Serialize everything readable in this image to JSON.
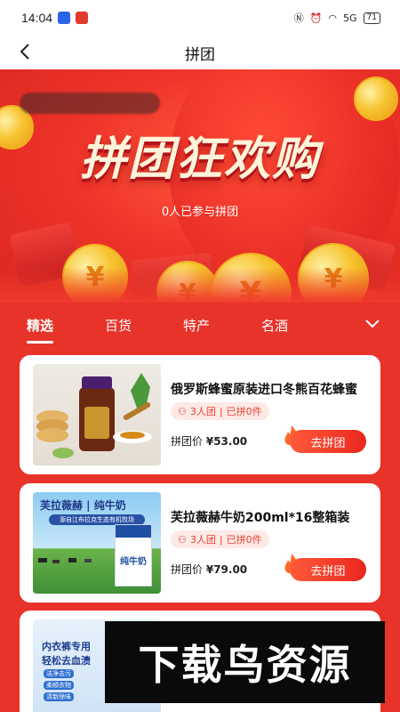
{
  "status": {
    "time": "14:04",
    "battery": "71",
    "net": "5G"
  },
  "nav": {
    "title": "拼团"
  },
  "banner": {
    "title": "拼团狂欢购",
    "participants": "0人已参与拼团"
  },
  "tabs": [
    {
      "label": "精选",
      "active": true
    },
    {
      "label": "百货",
      "active": false
    },
    {
      "label": "特产",
      "active": false
    },
    {
      "label": "名酒",
      "active": false
    }
  ],
  "products": [
    {
      "name": "俄罗斯蜂蜜原装进口冬熊百花蜂蜜",
      "group_size": "3人团",
      "joined": "已拼0件",
      "price_label": "拼团价",
      "price": "¥53.00",
      "button": "去拼团"
    },
    {
      "name": "芙拉薇赫牛奶200ml*16整箱装",
      "group_size": "3人团",
      "joined": "已拼0件",
      "price_label": "拼团价",
      "price": "¥79.00",
      "button": "去拼团",
      "thumb_text": {
        "brand": "芙拉薇赫 | 纯牛奶",
        "sub": "源自江布拉克生态有机牧场",
        "carton": "纯牛奶"
      }
    },
    {
      "name": "",
      "thumb_text": {
        "line1": "内衣裤专用",
        "line2": "轻松去血渍",
        "chips": [
          "洁净去污",
          "柔顺衣物",
          "清新除味"
        ]
      }
    }
  ],
  "watermark": "下载鸟资源",
  "colors": {
    "accent": "#e8332a",
    "tag_bg": "#fde9e5",
    "button": "#e8271e"
  }
}
